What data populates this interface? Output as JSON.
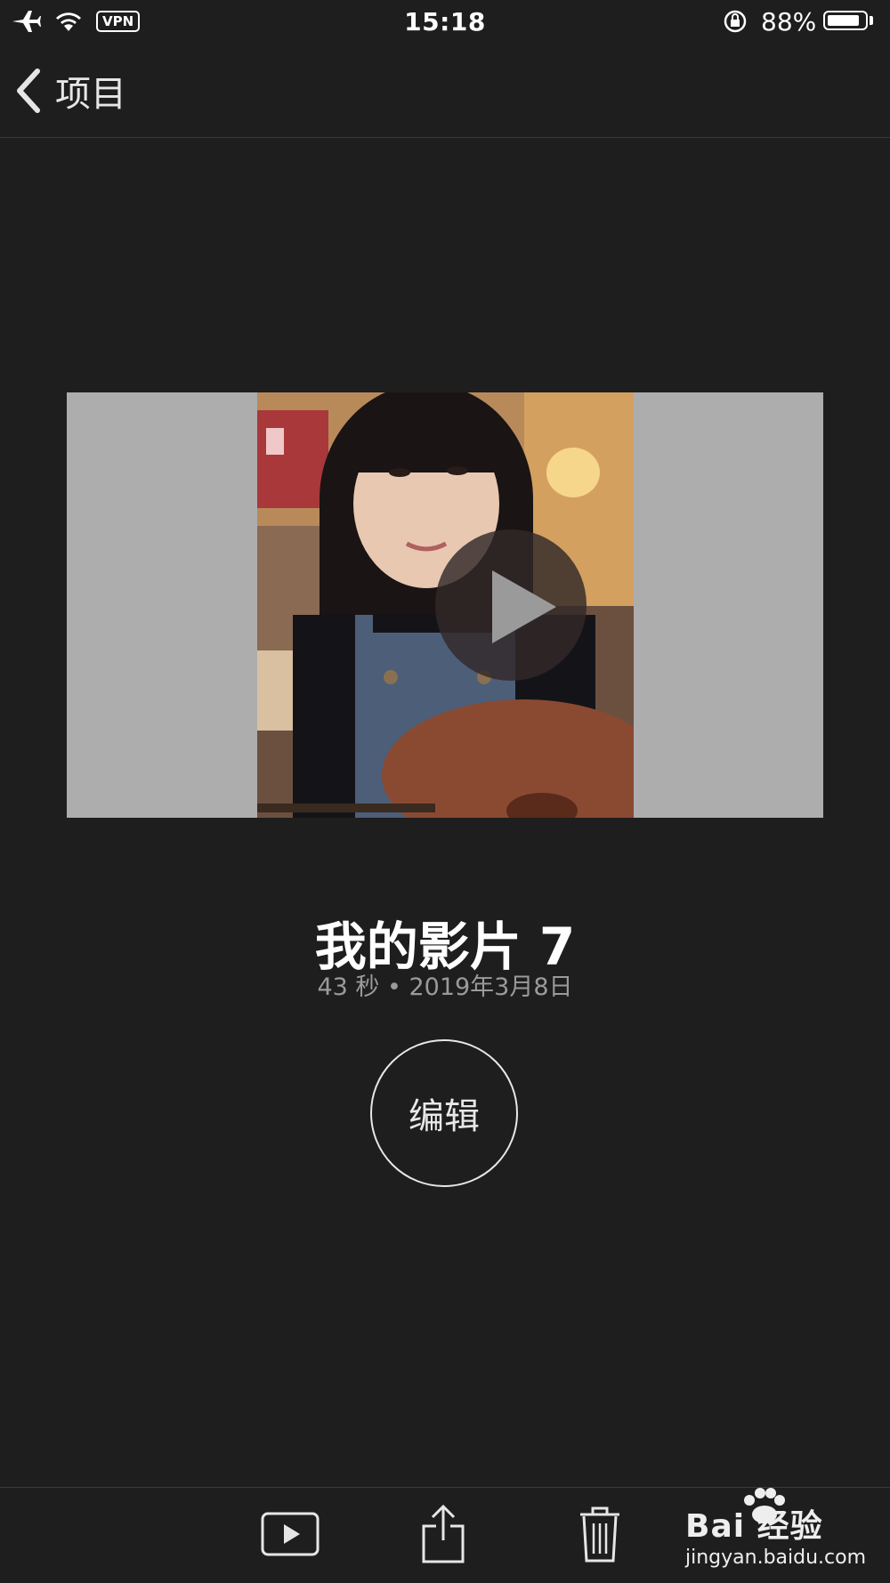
{
  "status_bar": {
    "time": "15:18",
    "vpn_label": "VPN",
    "battery_percent_text": "88%",
    "battery_level": 0.88,
    "icons": [
      "airplane-icon",
      "wifi-icon",
      "rotation-lock-icon",
      "battery-icon"
    ]
  },
  "nav": {
    "back_label": "项目"
  },
  "preview": {
    "letterbox_color": "#adadad"
  },
  "project": {
    "title": "我的影片 7",
    "meta": "43 秒 • 2019年3月8日"
  },
  "edit_button": {
    "label": "编辑"
  },
  "toolbar": {
    "items": [
      "play-icon",
      "share-icon",
      "trash-icon"
    ]
  },
  "watermark": {
    "logo_text": "Bai 经验",
    "url_text": "jingyan.baidu.com"
  },
  "colors": {
    "background": "#1e1e1e",
    "text_secondary": "#9a9a9a"
  }
}
